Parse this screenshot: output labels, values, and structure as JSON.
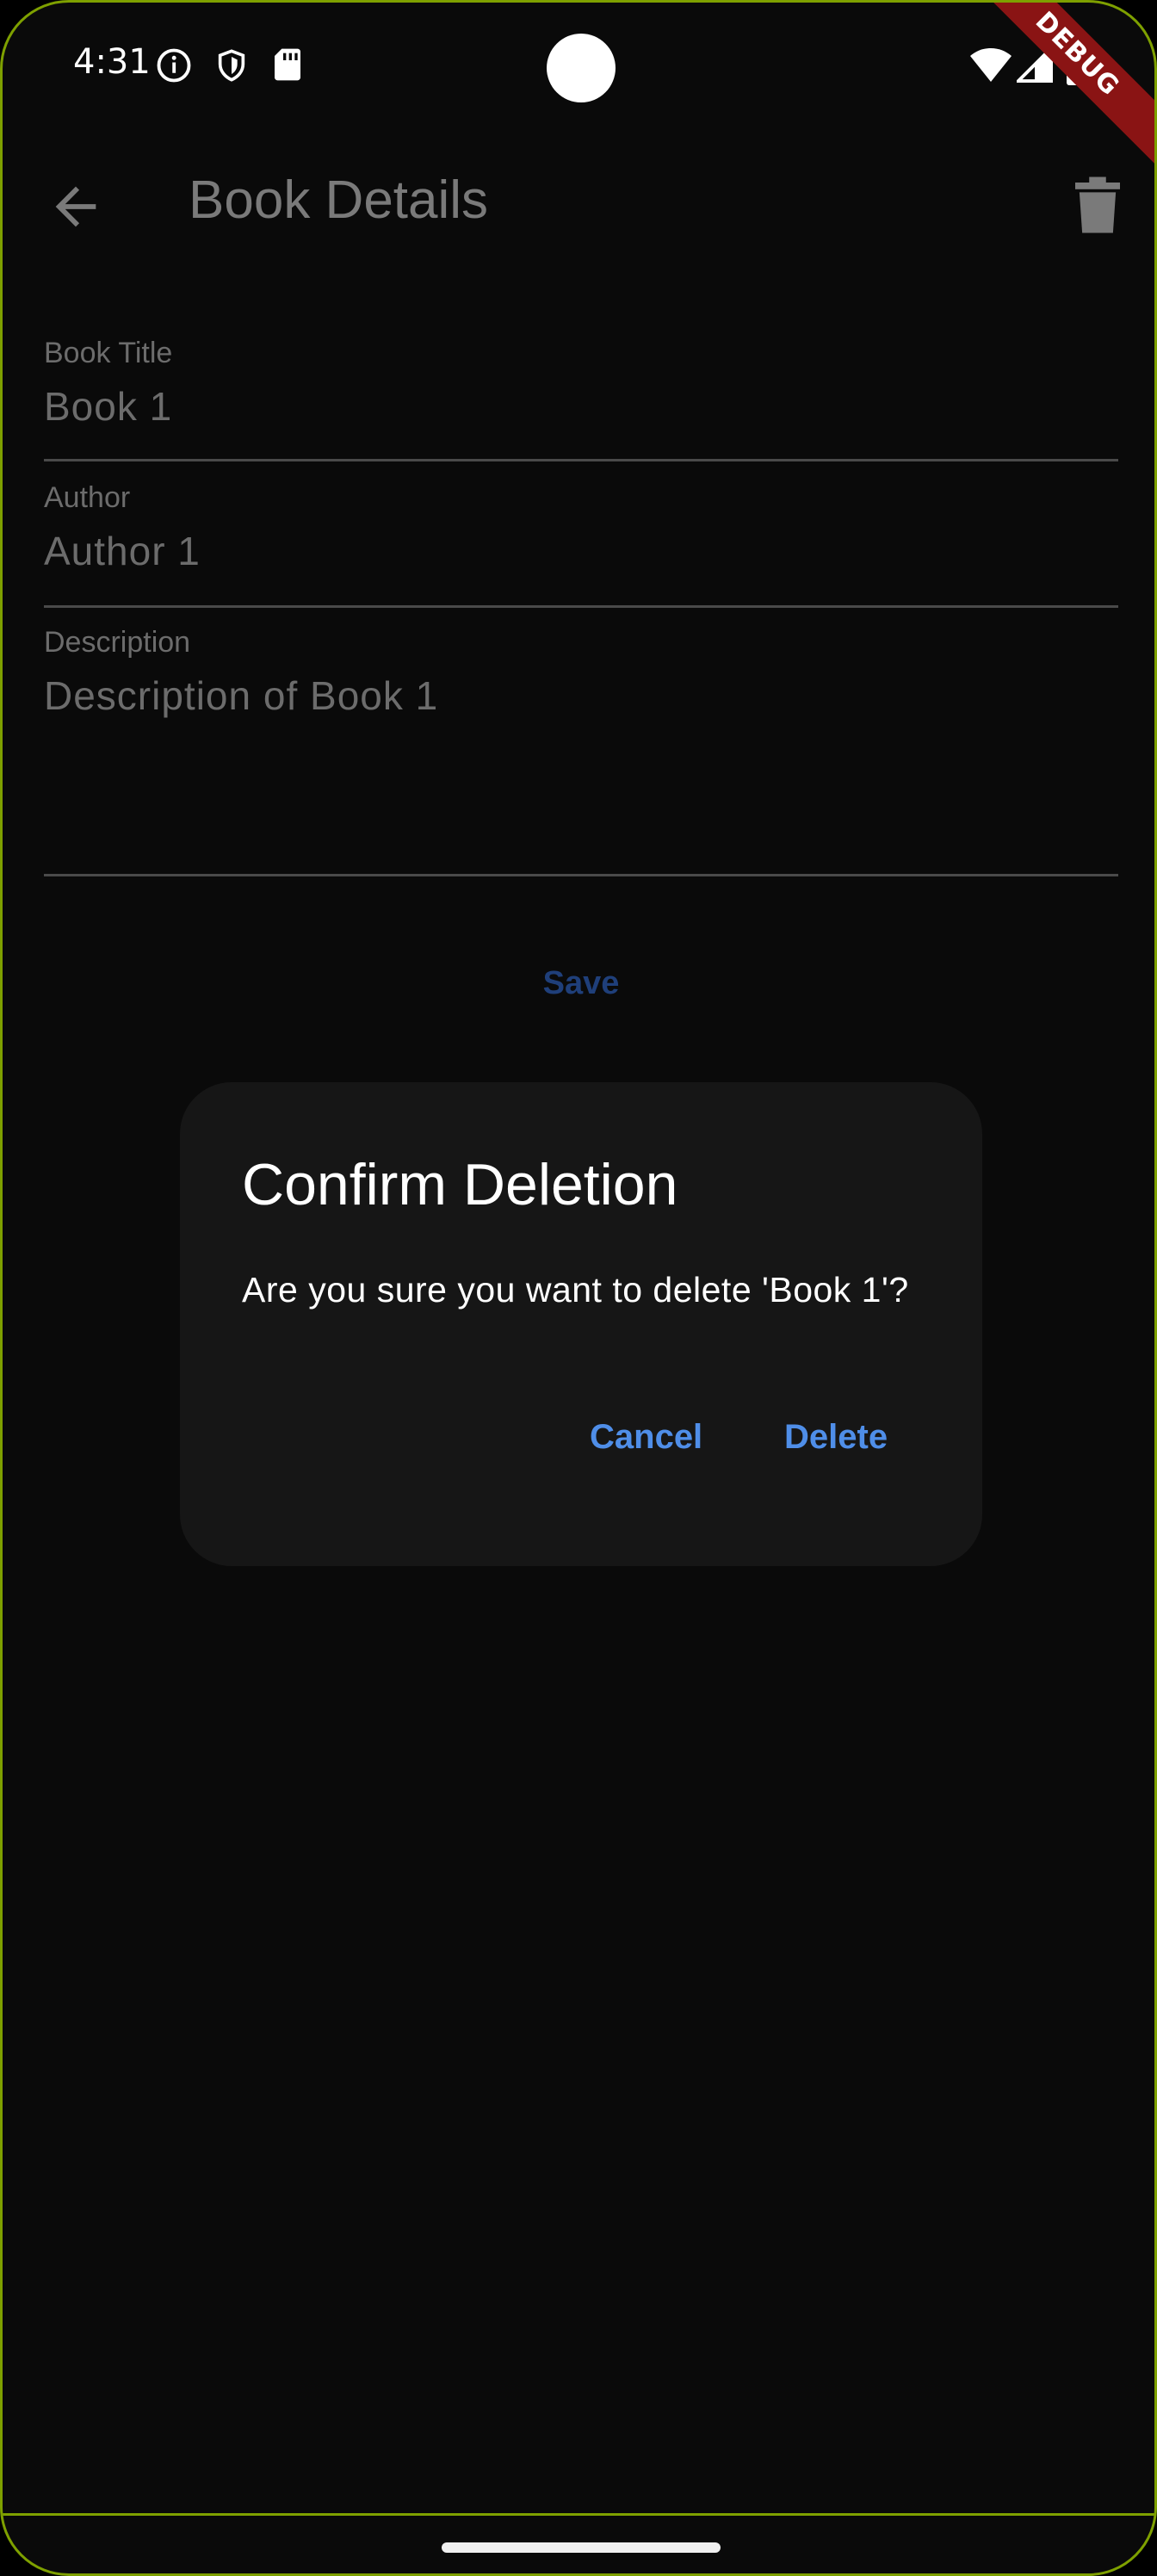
{
  "status_bar": {
    "time": "4:31",
    "icons": [
      "info-icon",
      "shield-icon",
      "sd-card-icon",
      "wifi-icon",
      "signal-icon",
      "battery-icon"
    ],
    "debug_banner": "DEBUG"
  },
  "app_bar": {
    "title": "Book Details",
    "back_icon": "arrow-back-icon",
    "delete_icon": "trash-icon"
  },
  "form": {
    "title": {
      "label": "Book Title",
      "value": "Book 1"
    },
    "author": {
      "label": "Author",
      "value": "Author 1"
    },
    "description": {
      "label": "Description",
      "value": "Description of Book 1"
    },
    "save_label": "Save"
  },
  "dialog": {
    "title": "Confirm Deletion",
    "message": "Are you sure you want to delete 'Book 1'?",
    "cancel_label": "Cancel",
    "delete_label": "Delete"
  },
  "colors": {
    "background": "#0a0a0a",
    "dialog_background": "#161616",
    "accent": "#4f8ee8",
    "frame": "#7ea000",
    "debug": "#8a1414"
  }
}
